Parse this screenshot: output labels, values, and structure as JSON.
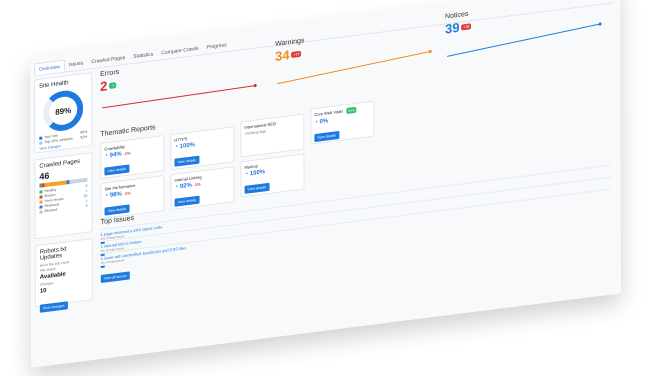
{
  "tabs": [
    "Overview",
    "Issues",
    "Crawled Pages",
    "Statistics",
    "Compare Crawls",
    "Progress"
  ],
  "site_health": {
    "title": "Site Health",
    "percent": "89%",
    "legend": [
      "Your site",
      "Top-10% websites",
      "View changes"
    ],
    "vals": [
      "89%",
      "92%"
    ]
  },
  "crawled": {
    "title": "Crawled Pages",
    "count": "46",
    "rows": [
      {
        "label": "Healthy",
        "value": "0",
        "color": "#2fbf71"
      },
      {
        "label": "Broken",
        "value": "1",
        "color": "#e23b3b"
      },
      {
        "label": "Have issues",
        "value": "22",
        "color": "#f4a02b"
      },
      {
        "label": "Redirects",
        "value": "1",
        "color": "#3a7bd5"
      },
      {
        "label": "Blocked",
        "value": "0",
        "color": "#b7c2cf"
      }
    ]
  },
  "robots": {
    "title": "Robots.txt Updates",
    "sub": "since the last crawl",
    "status_label": "File status",
    "status": "Available",
    "changes_label": "Changes",
    "changes": "10",
    "button": "View changes"
  },
  "metrics": {
    "errors": {
      "label": "Errors",
      "value": "2",
      "badge": "-1",
      "color": "#d92b2b",
      "badge_color": "#2fbf71"
    },
    "warnings": {
      "label": "Warnings",
      "value": "34",
      "badge": "+16",
      "color": "#f08b1c",
      "badge_color": "#e23b3b"
    },
    "notices": {
      "label": "Notices",
      "value": "39",
      "badge": "+38",
      "color": "#1f7ae0",
      "badge_color": "#e23b3b"
    }
  },
  "thematic": {
    "title": "Thematic Reports",
    "cards": [
      {
        "title": "Crawlability",
        "value": "94%",
        "delta": "-1%",
        "button": "View details"
      },
      {
        "title": "HTTPS",
        "value": "100%",
        "delta": "",
        "button": "View details"
      },
      {
        "title": "International SEO",
        "value": "",
        "delta": "",
        "button": ""
      },
      {
        "title": "Core Web Vitals",
        "value": "0%",
        "delta": "",
        "button": "View details",
        "badge": "new"
      },
      {
        "title": "Site Performance",
        "value": "98%",
        "delta": "-1%",
        "button": "View details"
      },
      {
        "title": "Internal Linking",
        "value": "92%",
        "delta": "-1%",
        "button": "View details"
      },
      {
        "title": "Markup",
        "value": "100%",
        "delta": "",
        "button": "View details"
      }
    ],
    "intl_note": "Hreflang tags"
  },
  "top_issues": {
    "title": "Top Issues",
    "items": [
      {
        "text": "1 page returned a 4XX status code",
        "sub": "0% of total issues"
      },
      {
        "text": "1 internal link is broken",
        "sub": "0% of total issues"
      },
      {
        "text": "1 issue with unminified JavaScript and CSS files",
        "sub": "0% of total issues"
      }
    ],
    "button": "View all issues"
  }
}
